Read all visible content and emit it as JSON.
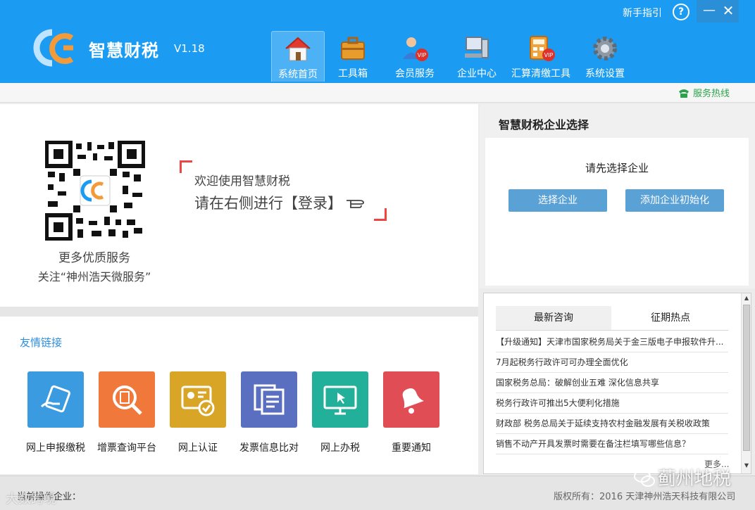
{
  "app": {
    "name": "智慧财税",
    "version": "V1.18",
    "guide_link": "新手指引",
    "help_label": "?",
    "minimize_label": "—",
    "close_label": "✕"
  },
  "nav": {
    "items": [
      {
        "label": "系统首页",
        "icon": "home-icon",
        "active": true
      },
      {
        "label": "工具箱",
        "icon": "toolbox-icon",
        "active": false
      },
      {
        "label": "会员服务",
        "icon": "vip-user-icon",
        "active": false
      },
      {
        "label": "企业中心",
        "icon": "computer-icon",
        "active": false
      },
      {
        "label": "汇算清缴工具",
        "icon": "calculator-vip-icon",
        "active": false
      },
      {
        "label": "系统设置",
        "icon": "gear-icon",
        "active": false
      }
    ]
  },
  "subbar": {
    "hotline": "服务热线"
  },
  "welcome": {
    "qr_caption_1": "更多优质服务",
    "qr_caption_2": "关注“神州浩天微服务”",
    "line1": "欢迎使用智慧财税",
    "line2": "请在右侧进行【登录】"
  },
  "links": {
    "title": "友情链接",
    "tiles": [
      {
        "label": "网上申报缴税",
        "color": "#3a9be0",
        "icon": "tax-card-icon"
      },
      {
        "label": "增票查询平台",
        "color": "#f0783a",
        "icon": "magnifier-doc-icon"
      },
      {
        "label": "网上认证",
        "color": "#d8a527",
        "icon": "id-card-check-icon"
      },
      {
        "label": "发票信息比对",
        "color": "#5a6fc0",
        "icon": "documents-icon"
      },
      {
        "label": "网上办税",
        "color": "#23b09a",
        "icon": "monitor-icon"
      },
      {
        "label": "重要通知",
        "color": "#e04d55",
        "icon": "bell-icon"
      }
    ]
  },
  "company": {
    "title": "智慧财税企业选择",
    "prompt": "请先选择企业",
    "select_btn": "选择企业",
    "add_btn": "添加企业初始化"
  },
  "news": {
    "tabs": [
      "最新咨询",
      "征期热点"
    ],
    "items": [
      "【升级通知】天津市国家税务局关于金三版电子申报软件升...",
      "7月起税务行政许可可办理全面优化",
      "国家税务总局：破解创业五难 深化信息共享",
      "税务行政许可推出5大便利化措施",
      "财政部 税务总局关于延续支持农村金融发展有关税收政策",
      "销售不动产开具发票时需要在备注栏填写哪些信息？"
    ],
    "more": "更多..."
  },
  "status": {
    "current_company": "当前操作企业：",
    "copyright": "版权所有：2016 天津神州浩天科技有限公司"
  },
  "watermarks": {
    "left": "大数跨境",
    "right": "蓟州地税"
  }
}
